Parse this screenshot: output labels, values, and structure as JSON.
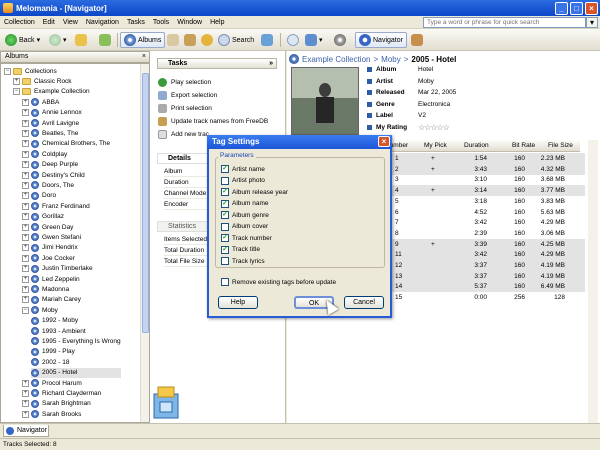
{
  "window": {
    "title": "Melomania - [Navigator]"
  },
  "menu": [
    "Collection",
    "Edit",
    "View",
    "Navigation",
    "Tasks",
    "Tools",
    "Window",
    "Help"
  ],
  "quicksearch": {
    "placeholder": "Type a word or phrase for quick search"
  },
  "toolbar": {
    "back": "Back",
    "albums": "Albums",
    "search": "Search",
    "navigator": "Navigator"
  },
  "albums_panel": {
    "title": "Albums"
  },
  "tree": [
    {
      "label": "Collections",
      "type": "folder",
      "indent": 0,
      "expanded": true
    },
    {
      "label": "Classic Rock",
      "type": "folder",
      "indent": 1,
      "expanded": false
    },
    {
      "label": "Example Collection",
      "type": "folder",
      "indent": 1,
      "expanded": true
    },
    {
      "label": "ABBA",
      "type": "cd",
      "indent": 2,
      "expanded": false
    },
    {
      "label": "Annie Lennox",
      "type": "cd",
      "indent": 2,
      "expanded": false
    },
    {
      "label": "Avril Lavigne",
      "type": "cd",
      "indent": 2,
      "expanded": false
    },
    {
      "label": "Beatles, The",
      "type": "cd",
      "indent": 2,
      "expanded": false
    },
    {
      "label": "Chemical Brothers, The",
      "type": "cd",
      "indent": 2,
      "expanded": false
    },
    {
      "label": "Coldplay",
      "type": "cd",
      "indent": 2,
      "expanded": false
    },
    {
      "label": "Deep Purple",
      "type": "cd",
      "indent": 2,
      "expanded": false
    },
    {
      "label": "Destiny's Child",
      "type": "cd",
      "indent": 2,
      "expanded": false
    },
    {
      "label": "Doors, The",
      "type": "cd",
      "indent": 2,
      "expanded": false
    },
    {
      "label": "Doro",
      "type": "cd",
      "indent": 2,
      "expanded": false
    },
    {
      "label": "Franz Ferdinand",
      "type": "cd",
      "indent": 2,
      "expanded": false
    },
    {
      "label": "Gorillaz",
      "type": "cd",
      "indent": 2,
      "expanded": false
    },
    {
      "label": "Green Day",
      "type": "cd",
      "indent": 2,
      "expanded": false
    },
    {
      "label": "Gwen Stefani",
      "type": "cd",
      "indent": 2,
      "expanded": false
    },
    {
      "label": "Jimi Hendrix",
      "type": "cd",
      "indent": 2,
      "expanded": false
    },
    {
      "label": "Joe Cocker",
      "type": "cd",
      "indent": 2,
      "expanded": false
    },
    {
      "label": "Justin Timberlake",
      "type": "cd",
      "indent": 2,
      "expanded": false
    },
    {
      "label": "Led Zeppelin",
      "type": "cd",
      "indent": 2,
      "expanded": false
    },
    {
      "label": "Madonna",
      "type": "cd",
      "indent": 2,
      "expanded": false
    },
    {
      "label": "Mariah Carey",
      "type": "cd",
      "indent": 2,
      "expanded": false
    },
    {
      "label": "Moby",
      "type": "cd",
      "indent": 2,
      "expanded": true
    },
    {
      "label": "1992 - Moby",
      "type": "cd",
      "indent": 3,
      "expanded": false
    },
    {
      "label": "1993 - Ambient",
      "type": "cd",
      "indent": 3,
      "expanded": false
    },
    {
      "label": "1995 - Everything Is Wrong",
      "type": "cd",
      "indent": 3,
      "expanded": false
    },
    {
      "label": "1999 - Play",
      "type": "cd",
      "indent": 3,
      "expanded": false
    },
    {
      "label": "2002 - 18",
      "type": "cd",
      "indent": 3,
      "expanded": false
    },
    {
      "label": "2005 - Hotel",
      "type": "cd",
      "indent": 3,
      "expanded": false,
      "selected": true
    },
    {
      "label": "Procol Harum",
      "type": "cd",
      "indent": 2,
      "expanded": false
    },
    {
      "label": "Richard Clayderman",
      "type": "cd",
      "indent": 2,
      "expanded": false
    },
    {
      "label": "Sarah Brightman",
      "type": "cd",
      "indent": 2,
      "expanded": false
    },
    {
      "label": "Sarah Brooks",
      "type": "cd",
      "indent": 2,
      "expanded": false
    }
  ],
  "tasks": {
    "title": "Tasks",
    "collapse": "»",
    "items": [
      "Play selection",
      "Export selection",
      "Print selection",
      "Update track names from FreeDB",
      "Add new trac"
    ]
  },
  "details": {
    "title": "Details",
    "rows": [
      "Album",
      "Duration",
      "Channel Mode",
      "Encoder"
    ]
  },
  "statistics": {
    "title": "Statistics",
    "rows": [
      "Items Selected",
      "Total Duration",
      "Total File Size"
    ]
  },
  "breadcrumb": {
    "a": "Example Collection",
    "sep1": ">",
    "b": "Moby",
    "sep2": ">",
    "c": "2005 - Hotel"
  },
  "album_info": [
    {
      "key": "Album",
      "value": "Hotel"
    },
    {
      "key": "Artist",
      "value": "Moby"
    },
    {
      "key": "Released",
      "value": "Mar 22, 2005"
    },
    {
      "key": "Genre",
      "value": "Electronica"
    },
    {
      "key": "Label",
      "value": "V2"
    },
    {
      "key": "My Rating",
      "value": "☆☆☆☆☆",
      "rating": 0
    }
  ],
  "tracks": {
    "columns": [
      "Number",
      "My Pick",
      "Duration",
      "Bit Rate",
      "File Size"
    ],
    "rows": [
      {
        "num": "1",
        "pick": "+",
        "dur": "1:54",
        "bit": "160",
        "size": "2.23 MB",
        "shade": true
      },
      {
        "num": "2",
        "pick": "+",
        "dur": "3:43",
        "bit": "160",
        "size": "4.32 MB",
        "shade": true
      },
      {
        "num": "3",
        "pick": "",
        "dur": "3:10",
        "bit": "160",
        "size": "3.68 MB",
        "shade": false
      },
      {
        "num": "4",
        "pick": "+",
        "dur": "3:14",
        "bit": "160",
        "size": "3.77 MB",
        "shade": true
      },
      {
        "num": "5",
        "pick": "",
        "dur": "3:18",
        "bit": "160",
        "size": "3.83 MB",
        "shade": false
      },
      {
        "num": "6",
        "pick": "",
        "dur": "4:52",
        "bit": "160",
        "size": "5.63 MB",
        "shade": false
      },
      {
        "num": "7",
        "pick": "",
        "dur": "3:42",
        "bit": "160",
        "size": "4.29 MB",
        "shade": false
      },
      {
        "num": "8",
        "pick": "",
        "dur": "2:39",
        "bit": "160",
        "size": "3.06 MB",
        "shade": false
      },
      {
        "num": "9",
        "pick": "+",
        "dur": "3:39",
        "bit": "160",
        "size": "4.25 MB",
        "shade": true
      },
      {
        "num": "11",
        "pick": "",
        "dur": "3:42",
        "bit": "160",
        "size": "4.29 MB",
        "shade": true
      },
      {
        "num": "12",
        "pick": "",
        "dur": "3:37",
        "bit": "160",
        "size": "4.19 MB",
        "shade": true
      },
      {
        "num": "13",
        "pick": "",
        "dur": "3:37",
        "bit": "160",
        "size": "4.19 MB",
        "shade": true
      },
      {
        "num": "14",
        "pick": "",
        "dur": "5:37",
        "bit": "160",
        "size": "6.49 MB",
        "shade": true
      },
      {
        "num": "15",
        "pick": "",
        "dur": "0:00",
        "bit": "256",
        "size": "128",
        "shade": false
      }
    ]
  },
  "dialog": {
    "title": "Tag Settings",
    "close": "×",
    "group_label": "Parameters",
    "options": [
      {
        "label": "Artist name",
        "checked": true
      },
      {
        "label": "Artist photo",
        "checked": false
      },
      {
        "label": "Album release year",
        "checked": true
      },
      {
        "label": "Album name",
        "checked": true
      },
      {
        "label": "Album genre",
        "checked": true
      },
      {
        "label": "Album cover",
        "checked": false
      },
      {
        "label": "Track number",
        "checked": true
      },
      {
        "label": "Track title",
        "checked": true
      },
      {
        "label": "Track lyrics",
        "checked": false
      }
    ],
    "remove_existing": {
      "label": "Remove existing tags before update",
      "checked": false
    },
    "help": "Help",
    "ok": "OK",
    "cancel": "Cancel"
  },
  "bottom_tab": {
    "label": "Navigator"
  },
  "status": {
    "text": "Tracks Selected: 8"
  },
  "colors": {
    "titlebar": "#0b47c8",
    "link": "#3d5fa9",
    "selected_row": "#e3e3e3",
    "check": "#21a121"
  }
}
